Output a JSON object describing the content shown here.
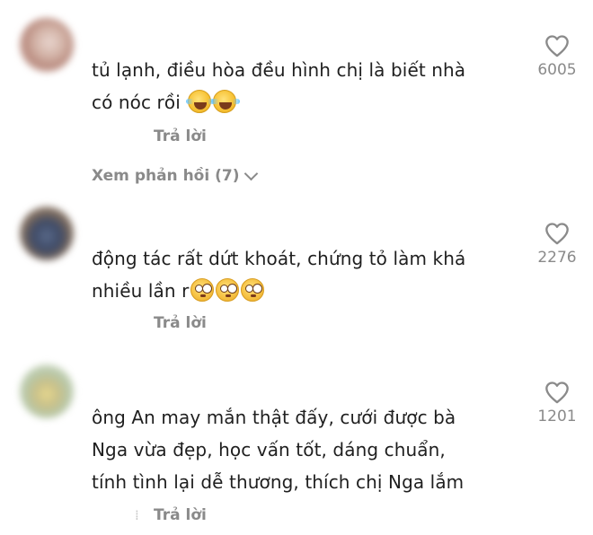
{
  "comments": [
    {
      "text": "tủ lạnh, điều hòa đều hình chị là biết nhà\ncó nóc rồi ",
      "emojis": [
        "emoji-laugh",
        "emoji-laugh"
      ],
      "likes": "6005",
      "reply_label": "Trả lời",
      "view_replies_label": "Xem phản hồi (7)"
    },
    {
      "text": "động tác rất dứt khoát, chứng tỏ làm khá\nnhiều lần r",
      "emojis": [
        "emoji-flushed",
        "emoji-flushed",
        "emoji-flushed"
      ],
      "likes": "2276",
      "reply_label": "Trả lời"
    },
    {
      "text": "ông An may mắn thật đấy, cưới được bà\nNga vừa đẹp, học vấn tốt, dáng chuẩn,\ntính tình lại dễ thương, thích chị Nga lắm",
      "emojis": [],
      "likes": "1201",
      "reply_label": "Trả lời"
    }
  ],
  "icons": {
    "heart": "heart-outline-icon",
    "chevron": "chevron-down-icon"
  },
  "colors": {
    "text": "#1f1f1f",
    "muted": "#8a8a8a"
  }
}
